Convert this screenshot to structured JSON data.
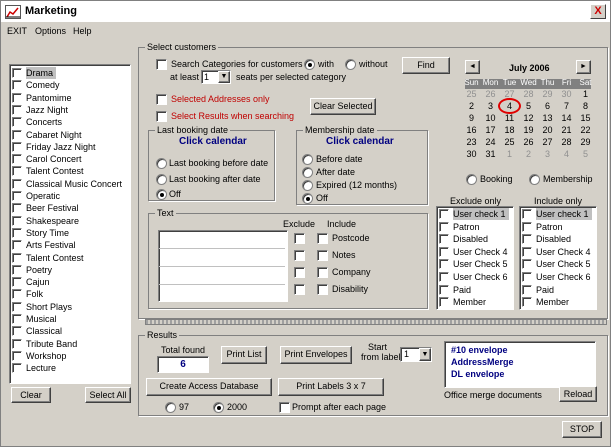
{
  "window": {
    "title": "Marketing",
    "close_label": "X"
  },
  "menu": [
    "EXIT",
    "Options",
    "Help"
  ],
  "categories": {
    "items": [
      "Drama",
      "Comedy",
      "Pantomime",
      "Jazz Night",
      "Concerts",
      "Cabaret Night",
      "Friday Jazz Night",
      "Carol Concert",
      "Talent Contest",
      "Classical Music Concert",
      "Operatic",
      "Beer Festival",
      "Shakespeare",
      "Story Time",
      "Arts Festival",
      "Talent Contest",
      "Poetry",
      "Cajun",
      "Folk",
      "Short Plays",
      "Musical",
      "Classical",
      "Tribute Band",
      "Workshop",
      "Lecture"
    ],
    "selected_index": 0,
    "clear_label": "Clear",
    "select_all_label": "Select All"
  },
  "select_customers": {
    "group_label": "Select customers",
    "search_categories_label": "Search Categories for customers",
    "with_label": "with",
    "without_label": "without",
    "with_selected": true,
    "at_least_label": "at least",
    "seats_value": "1",
    "seats_label": "seats per selected category",
    "find_label": "Find",
    "selected_addresses_label": "Selected Addresses only",
    "select_results_label": "Select Results when searching",
    "clear_selected_label": "Clear Selected"
  },
  "last_booking": {
    "group_label": "Last booking date",
    "calendar_link": "Click calendar",
    "options": [
      "Last booking before date",
      "Last booking after date",
      "Off"
    ],
    "selected": 2
  },
  "membership": {
    "group_label": "Membership date",
    "calendar_link": "Click calendar",
    "options": [
      "Before date",
      "After date",
      "Expired (12 months)",
      "Off"
    ],
    "selected": 3
  },
  "text_group": {
    "group_label": "Text",
    "exclude_header": "Exclude",
    "include_header": "Include",
    "fields": [
      "Postcode",
      "Notes",
      "Company",
      "Disability"
    ]
  },
  "calendar": {
    "month_label": "July 2006",
    "prev_icon": "◄",
    "next_icon": "►",
    "weekdays": [
      "Sun",
      "Mon",
      "Tue",
      "Wed",
      "Thu",
      "Fri",
      "Sat"
    ],
    "weeks": [
      [
        "25",
        "26",
        "27",
        "28",
        "29",
        "30",
        "1"
      ],
      [
        "2",
        "3",
        "4",
        "5",
        "6",
        "7",
        "8"
      ],
      [
        "9",
        "10",
        "11",
        "12",
        "13",
        "14",
        "15"
      ],
      [
        "16",
        "17",
        "18",
        "19",
        "20",
        "21",
        "22"
      ],
      [
        "23",
        "24",
        "25",
        "26",
        "27",
        "28",
        "29"
      ],
      [
        "30",
        "31",
        "1",
        "2",
        "3",
        "4",
        "5"
      ]
    ],
    "today": "4",
    "booking_label": "Booking",
    "membership_label": "Membership"
  },
  "exclude_only": {
    "header": "Exclude only",
    "items": [
      "User check 1",
      "Patron",
      "Disabled",
      "User Check 4",
      "User Check 5",
      "User Check 6",
      "Paid",
      "Member"
    ]
  },
  "include_only": {
    "header": "Include only",
    "items": [
      "User check 1",
      "Patron",
      "Disabled",
      "User Check 4",
      "User Check 5",
      "User Check 6",
      "Paid",
      "Member"
    ]
  },
  "results": {
    "group_label": "Results",
    "total_found_label": "Total found",
    "total_found_value": "6",
    "print_list_label": "Print List",
    "print_envelopes_label": "Print Envelopes",
    "start_from_label_line1": "Start",
    "start_from_label_line2": "from label",
    "start_label_value": "1",
    "create_access_label": "Create Access Database",
    "print_labels_label": "Print Labels 3 x 7",
    "version_97": "97",
    "version_2000": "2000",
    "version_selected": "2000",
    "prompt_label": "Prompt after each page"
  },
  "merge_docs": {
    "items": [
      "#10 envelope",
      "AddressMerge",
      "DL envelope"
    ],
    "caption": "Office merge documents",
    "reload_label": "Reload"
  },
  "stop_label": "STOP",
  "colors": {
    "face": "#d4d0c8",
    "link": "#000080",
    "warning": "#c00000",
    "today_ring": "#e00000"
  }
}
